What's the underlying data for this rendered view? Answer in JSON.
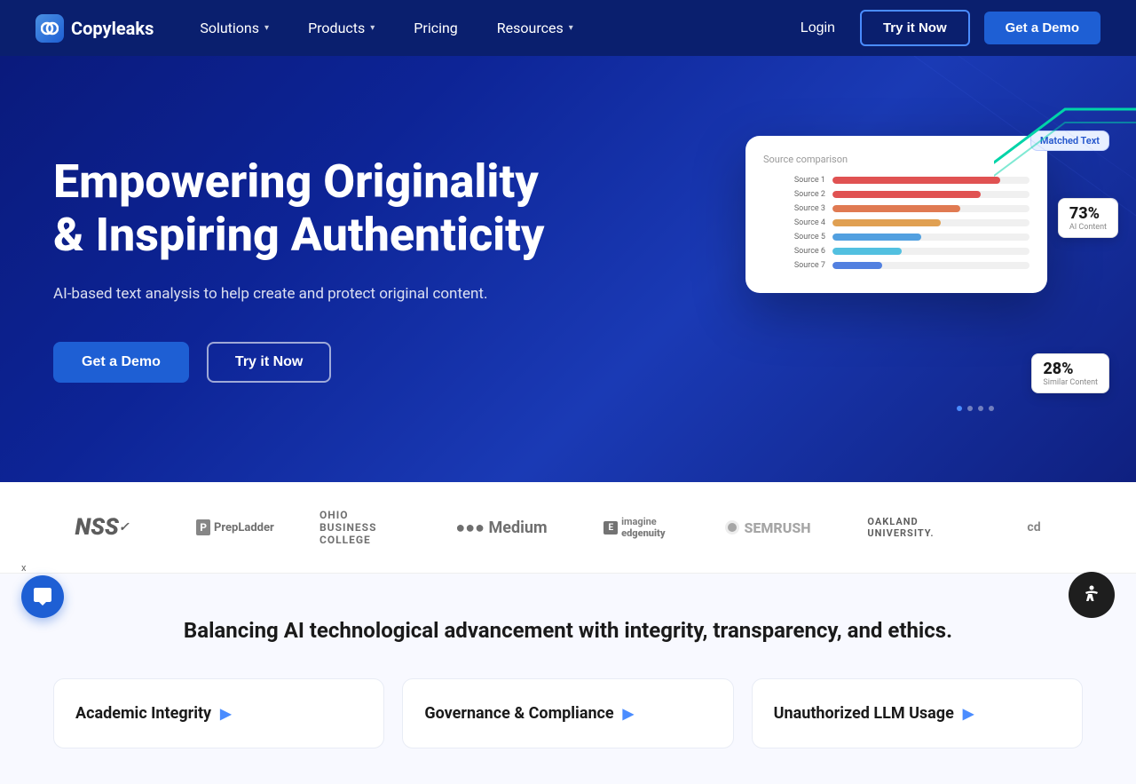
{
  "nav": {
    "logo_text": "Copyleaks",
    "items": [
      {
        "label": "Solutions",
        "has_dropdown": true
      },
      {
        "label": "Products",
        "has_dropdown": true
      },
      {
        "label": "Pricing",
        "has_dropdown": false
      },
      {
        "label": "Resources",
        "has_dropdown": true
      }
    ],
    "login_label": "Login",
    "try_now_label": "Try it Now",
    "get_demo_label": "Get a Demo"
  },
  "hero": {
    "title_line1": "Empowering Originality",
    "title_line2": "& Inspiring Authenticity",
    "subtitle": "AI-based text analysis to help create and protect original content.",
    "btn_demo": "Get a Demo",
    "btn_try": "Try it Now",
    "badge_matched": "Matched Text",
    "badge_ai_pct": "73%",
    "badge_ai_label": "AI Content",
    "badge_similar_pct": "28%",
    "badge_similar_label": "Similar Content",
    "bars": [
      {
        "color": "#e05252",
        "width": "85%"
      },
      {
        "color": "#e05252",
        "width": "75%"
      },
      {
        "color": "#e07a52",
        "width": "65%"
      },
      {
        "color": "#e0a052",
        "width": "55%"
      },
      {
        "color": "#52a0e0",
        "width": "45%"
      },
      {
        "color": "#52c0e0",
        "width": "35%"
      },
      {
        "color": "#5280e0",
        "width": "25%"
      }
    ]
  },
  "logos": [
    {
      "name": "NSS",
      "display": "NSS",
      "style": "nss"
    },
    {
      "name": "PrepLadder",
      "display": "PrepLadder",
      "style": "prepladder"
    },
    {
      "name": "Ohio Business College",
      "display": "OHIO BUSINESS COLLEGE",
      "style": "ohio"
    },
    {
      "name": "Medium",
      "display": "Medium",
      "style": "medium"
    },
    {
      "name": "Imagine Edgenuity",
      "display": "imagine edgenuity",
      "style": "edgenuity"
    },
    {
      "name": "SEMRush",
      "display": "SEMRUSH",
      "style": "semrush"
    },
    {
      "name": "Oakland University",
      "display": "OAKLAND UNIVERSITY.",
      "style": "oakland"
    }
  ],
  "lower": {
    "title": "Balancing AI technological advancement with integrity, transparency, and ethics.",
    "cards": [
      {
        "title": "Academic Integrity",
        "arrow": "▶"
      },
      {
        "title": "Governance & Compliance",
        "arrow": "▶"
      },
      {
        "title": "Unauthorized LLM Usage",
        "arrow": "▶"
      }
    ]
  },
  "chat": {
    "close_label": "x"
  },
  "accessibility": {
    "label": "Accessibility"
  }
}
